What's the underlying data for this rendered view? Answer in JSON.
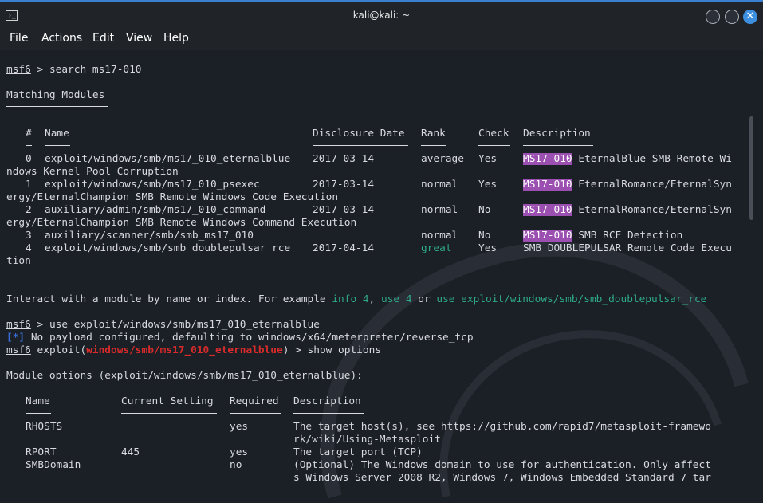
{
  "window": {
    "title": "kali@kali: ~",
    "app_icon_glyph": "›_",
    "close_glyph": "✕"
  },
  "menu": [
    "File",
    "Actions",
    "Edit",
    "View",
    "Help"
  ],
  "terminal": {
    "prompt": "msf6",
    "cmd1": " > search ms17-010",
    "matching_modules": "Matching Modules",
    "table_header": {
      "num": "#",
      "name": "Name",
      "date": "Disclosure Date",
      "rank": "Rank",
      "check": "Check",
      "desc": "Description"
    },
    "modules": [
      {
        "num": "0",
        "name": "exploit/windows/smb/ms17_010_eternalblue",
        "date": "2017-03-14",
        "rank": "average",
        "check": "Yes",
        "tag": "MS17-010",
        "desc": " EternalBlue SMB Remote Wi",
        "cont": "ndows Kernel Pool Corruption"
      },
      {
        "num": "1",
        "name": "exploit/windows/smb/ms17_010_psexec",
        "date": "2017-03-14",
        "rank": "normal",
        "check": "Yes",
        "tag": "MS17-010",
        "desc": " EternalRomance/EternalSyn",
        "cont": "ergy/EternalChampion SMB Remote Windows Code Execution"
      },
      {
        "num": "2",
        "name": "auxiliary/admin/smb/ms17_010_command",
        "date": "2017-03-14",
        "rank": "normal",
        "check": "No",
        "tag": "MS17-010",
        "desc": " EternalRomance/EternalSyn",
        "cont": "ergy/EternalChampion SMB Remote Windows Command Execution"
      },
      {
        "num": "3",
        "name": "auxiliary/scanner/smb/smb_ms17_010",
        "date": "",
        "rank": "normal",
        "check": "No",
        "tag": "MS17-010",
        "desc": " SMB RCE Detection",
        "cont": ""
      },
      {
        "num": "4",
        "name": "exploit/windows/smb/smb_doublepulsar_rce",
        "date": "2017-04-14",
        "rank": "great",
        "check": "Yes",
        "tag": "",
        "desc": "SMB DOUBLEPULSAR Remote Code Execu",
        "cont": "tion"
      }
    ],
    "interact_prefix": "Interact with a module by name or index. For example ",
    "interact_ex1": "info 4",
    "interact_sep1": ", ",
    "interact_ex2": "use 4",
    "interact_sep2": " or ",
    "interact_ex3": "use exploit/windows/smb/smb_doublepulsar_rce",
    "cmd2": " > use exploit/windows/smb/ms17_010_eternalblue",
    "info_marker": "[*]",
    "info_msg": " No payload configured, defaulting to windows/x64/meterpreter/reverse_tcp",
    "exploit_word": " exploit(",
    "exploit_module": "windows/smb/ms17_010_eternalblue",
    "cmd3": ") > show options",
    "module_options": "Module options (exploit/windows/smb/ms17_010_eternalblue):",
    "opt_header": {
      "name": "Name",
      "setting": "Current Setting",
      "required": "Required",
      "desc": "Description"
    },
    "options": [
      {
        "name": "RHOSTS",
        "setting": "",
        "required": "yes",
        "desc": "The target host(s), see https://github.com/rapid7/metasploit-framewo",
        "cont": "rk/wiki/Using-Metasploit"
      },
      {
        "name": "RPORT",
        "setting": "445",
        "required": "yes",
        "desc": "The target port (TCP)",
        "cont": ""
      },
      {
        "name": "SMBDomain",
        "setting": "",
        "required": "no",
        "desc": "(Optional) The Windows domain to use for authentication. Only affect",
        "cont": "s Windows Server 2008 R2, Windows 7, Windows Embedded Standard 7 tar"
      }
    ]
  },
  "colors": {
    "background": "#1b1f26",
    "text": "#d8dadf",
    "highlight": "#9b4fb0",
    "green": "#2fa98b",
    "red": "#d92b2b",
    "blue": "#3a6fd8",
    "accent": "#3b7fd0"
  }
}
